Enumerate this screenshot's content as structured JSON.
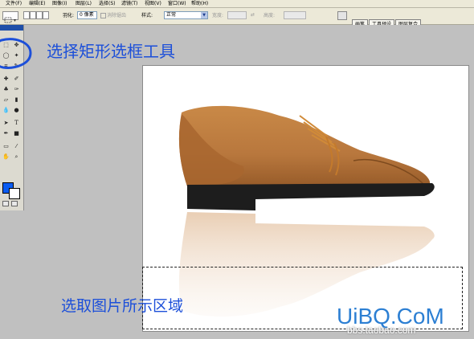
{
  "menubar": {
    "items": [
      "文件(F)",
      "编辑(E)",
      "图像(I)",
      "图层(L)",
      "选择(S)",
      "滤镜(T)",
      "视图(V)",
      "窗口(W)",
      "帮助(H)"
    ]
  },
  "options_bar": {
    "feather_label": "羽化:",
    "feather_value": "0 像素",
    "antialias_label": "消除锯齿",
    "style_label": "样式:",
    "style_value": "正常",
    "width_label": "宽度:",
    "height_label": "高度:"
  },
  "palette_tabs": [
    "画笔",
    "工具预设",
    "图层复合"
  ],
  "tools": {
    "icons": [
      "rect-marquee-icon",
      "move-icon",
      "lasso-icon",
      "magic-wand-icon",
      "crop-icon",
      "slice-icon",
      "healing-brush-icon",
      "brush-icon",
      "clone-stamp-icon",
      "history-brush-icon",
      "eraser-icon",
      "gradient-icon",
      "blur-icon",
      "dodge-icon",
      "path-selection-icon",
      "type-icon",
      "pen-icon",
      "custom-shape-icon",
      "notes-icon",
      "eyedropper-icon",
      "hand-icon",
      "zoom-icon"
    ],
    "foreground_color": "#0a5cf2",
    "background_color": "#ffffff"
  },
  "annotations": {
    "tool_hint": "选择矩形选框工具",
    "area_hint": "选取图片所示区域"
  },
  "watermark": {
    "brand": "UiBQ.CoM",
    "url": "bbs.taobao.com"
  },
  "colors": {
    "annotation_blue": "#1c4fd9",
    "shoe_leather": "#b8773d",
    "sole": "#1d1d1d"
  }
}
